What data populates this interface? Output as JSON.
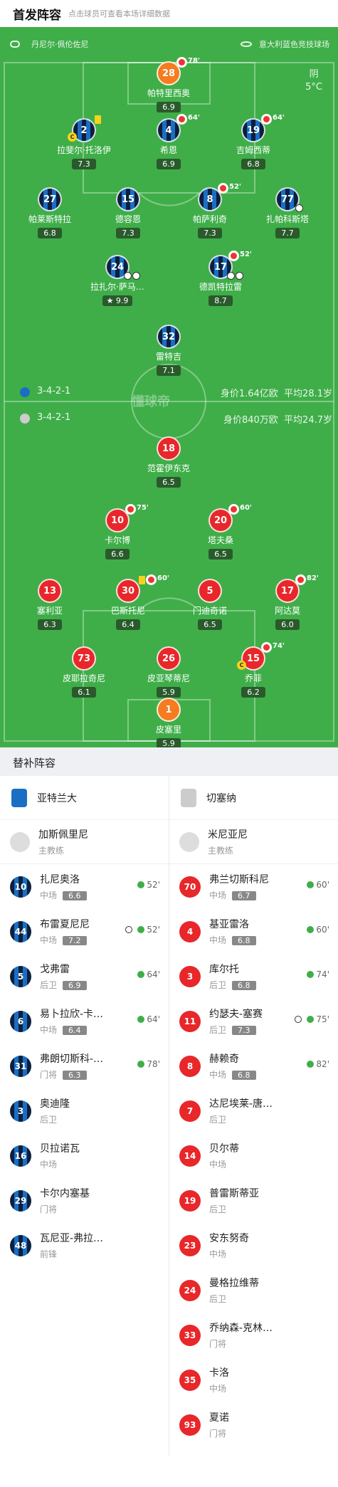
{
  "header": {
    "title": "首发阵容",
    "hint": "点击球员可查看本场详细数据"
  },
  "venue": {
    "left": "丹尼尔·佩伦佐尼",
    "right": "意大利蓝色竞技球场"
  },
  "weather": {
    "desc": "阴",
    "temp": "5°C"
  },
  "watermark": "懂球帝",
  "home_info": {
    "formation": "3-4-2-1",
    "value": "身价1.64亿欧",
    "age": "平均28.1岁"
  },
  "away_info": {
    "formation": "3-4-2-1",
    "value": "身价840万欧",
    "age": "平均24.7岁"
  },
  "home_players": [
    {
      "num": "28",
      "name": "帕特里西奥",
      "rating": "6.9",
      "sub": "78'"
    },
    {
      "num": "2",
      "name": "拉斐尔·托洛伊",
      "rating": "7.3"
    },
    {
      "num": "4",
      "name": "希恩",
      "rating": "6.9",
      "sub": "64'"
    },
    {
      "num": "19",
      "name": "吉姆西蒂",
      "rating": "6.8",
      "sub": "64'"
    },
    {
      "num": "27",
      "name": "帕莱斯特拉",
      "rating": "6.8"
    },
    {
      "num": "15",
      "name": "德容恩",
      "rating": "7.3"
    },
    {
      "num": "8",
      "name": "帕萨利奇",
      "rating": "7.3",
      "sub": "52'"
    },
    {
      "num": "77",
      "name": "扎帕科斯塔",
      "rating": "7.7"
    },
    {
      "num": "24",
      "name": "拉扎尔·萨马…",
      "rating": "9.9"
    },
    {
      "num": "17",
      "name": "德凯特拉雷",
      "rating": "8.7",
      "sub": "52'"
    },
    {
      "num": "32",
      "name": "雷特吉",
      "rating": "7.1"
    }
  ],
  "away_players": [
    {
      "num": "18",
      "name": "范霍伊东克",
      "rating": "6.5"
    },
    {
      "num": "10",
      "name": "卡尔博",
      "rating": "6.6",
      "sub": "75'"
    },
    {
      "num": "20",
      "name": "塔夫桑",
      "rating": "6.5",
      "sub": "60'"
    },
    {
      "num": "13",
      "name": "塞利亚",
      "rating": "6.3"
    },
    {
      "num": "30",
      "name": "巴斯托尼",
      "rating": "6.4",
      "sub": "60'"
    },
    {
      "num": "5",
      "name": "门迪奇诺",
      "rating": "6.5"
    },
    {
      "num": "17",
      "name": "阿达莫",
      "rating": "6.0",
      "sub": "82'"
    },
    {
      "num": "73",
      "name": "皮耶拉奇尼",
      "rating": "6.1"
    },
    {
      "num": "26",
      "name": "皮亚琴蒂尼",
      "rating": "5.9"
    },
    {
      "num": "15",
      "name": "乔菲",
      "rating": "6.2",
      "sub": "74'"
    },
    {
      "num": "1",
      "name": "皮塞里",
      "rating": "5.9"
    }
  ],
  "subs": {
    "title": "替补阵容",
    "home_team": "亚特兰大",
    "away_team": "切塞纳",
    "home_coach": {
      "name": "加斯佩里尼",
      "role": "主教练"
    },
    "away_coach": {
      "name": "米尼亚尼",
      "role": "主教练"
    },
    "home": [
      {
        "num": "10",
        "name": "扎尼奥洛",
        "pos": "中场",
        "rating": "6.6",
        "time": "52'"
      },
      {
        "num": "44",
        "name": "布雷夏尼尼",
        "pos": "中场",
        "rating": "7.2",
        "time": "52'"
      },
      {
        "num": "5",
        "name": "戈弗雷",
        "pos": "后卫",
        "rating": "6.9",
        "time": "64'"
      },
      {
        "num": "6",
        "name": "易卜拉欣-卡…",
        "pos": "中场",
        "rating": "6.4",
        "time": "64'"
      },
      {
        "num": "31",
        "name": "弗朗切斯科-…",
        "pos": "门将",
        "rating": "6.3",
        "time": "78'"
      },
      {
        "num": "3",
        "name": "奥迪隆",
        "pos": "后卫"
      },
      {
        "num": "16",
        "name": "贝拉诺瓦",
        "pos": "中场"
      },
      {
        "num": "29",
        "name": "卡尔内塞基",
        "pos": "门将"
      },
      {
        "num": "48",
        "name": "瓦尼亚-弗拉…",
        "pos": "前锋"
      }
    ],
    "away": [
      {
        "num": "70",
        "name": "弗兰切斯科尼",
        "pos": "中场",
        "rating": "6.7",
        "time": "60'"
      },
      {
        "num": "4",
        "name": "基亚雷洛",
        "pos": "中场",
        "rating": "6.8",
        "time": "60'"
      },
      {
        "num": "3",
        "name": "库尔托",
        "pos": "后卫",
        "rating": "6.8",
        "time": "74'"
      },
      {
        "num": "11",
        "name": "约瑟夫-塞赛",
        "pos": "后卫",
        "rating": "7.3",
        "time": "75'"
      },
      {
        "num": "8",
        "name": "赫赖奇",
        "pos": "中场",
        "rating": "6.8",
        "time": "82'"
      },
      {
        "num": "7",
        "name": "达尼埃莱-唐…",
        "pos": "后卫"
      },
      {
        "num": "14",
        "name": "贝尔蒂",
        "pos": "中场"
      },
      {
        "num": "19",
        "name": "普雷斯蒂亚",
        "pos": "后卫"
      },
      {
        "num": "23",
        "name": "安东努奇",
        "pos": "中场"
      },
      {
        "num": "24",
        "name": "曼格拉维蒂",
        "pos": "后卫"
      },
      {
        "num": "33",
        "name": "乔纳森-克林…",
        "pos": "门将"
      },
      {
        "num": "35",
        "name": "卡洛",
        "pos": "中场"
      },
      {
        "num": "93",
        "name": "夏诺",
        "pos": "门将"
      }
    ]
  },
  "colors": {
    "pitch": "#3fae49",
    "home_dark": "#0d1f3c",
    "home_blue": "#1a6fc4",
    "away_red": "#e8272a",
    "gk_orange": "#f57c20"
  }
}
